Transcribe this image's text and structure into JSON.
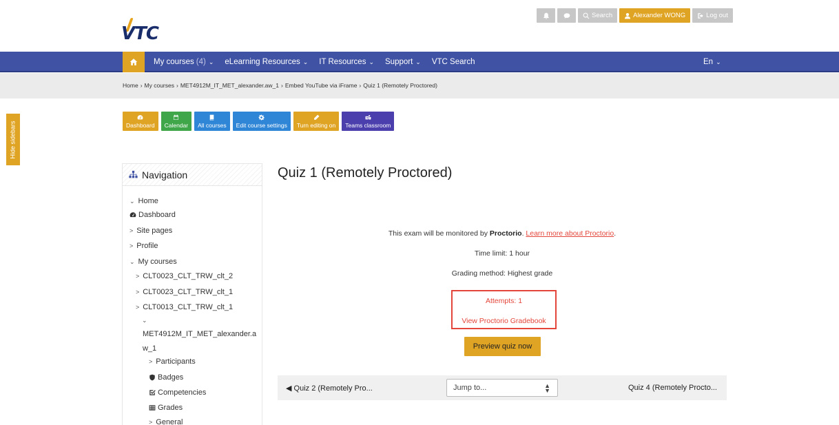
{
  "header": {
    "logo_text": "VTC",
    "search_label": "Search",
    "user_label": "Alexander WONG",
    "logout_label": "Log out"
  },
  "navbar": {
    "my_courses": "My courses",
    "my_courses_count": "(4)",
    "elearning": "eLearning Resources",
    "it_resources": "IT Resources",
    "support": "Support",
    "vtc_search": "VTC Search",
    "lang": "En"
  },
  "breadcrumb": {
    "home": "Home",
    "my_courses": "My courses",
    "course": "MET4912M_IT_MET_alexander.aw_1",
    "section": "Embed YouTube via iFrame",
    "current": "Quiz 1 (Remotely Proctored)"
  },
  "hide_sidebars": "Hide sidebars",
  "course_buttons": {
    "dashboard": "Dashboard",
    "calendar": "Calendar",
    "all_courses": "All courses",
    "edit_settings": "Edit course settings",
    "editing_on": "Turn editing on",
    "teams": "Teams classroom"
  },
  "navigation": {
    "title": "Navigation",
    "home": "Home",
    "dashboard": "Dashboard",
    "site_pages": "Site pages",
    "profile": "Profile",
    "my_courses": "My courses",
    "course1": "CLT0023_CLT_TRW_clt_2",
    "course2": "CLT0023_CLT_TRW_clt_1",
    "course3": "CLT0013_CLT_TRW_clt_1",
    "course4_line1": "MET4912M_IT_MET_alexander.a",
    "course4_line2": "w_1",
    "participants": "Participants",
    "badges": "Badges",
    "competencies": "Competencies",
    "grades": "Grades",
    "general": "General"
  },
  "main": {
    "title": "Quiz 1 (Remotely Proctored)",
    "monitored_prefix": "This exam will be monitored by ",
    "monitored_brand": "Proctorio",
    "monitored_suffix": ". ",
    "learn_more": "Learn more about Proctorio",
    "learn_more_end": ".",
    "time_limit": "Time limit: 1 hour",
    "grading": "Grading method: Highest grade",
    "attempts": "Attempts: 1",
    "gradebook": "View Proctorio Gradebook",
    "preview": "Preview quiz now"
  },
  "pager": {
    "prev": "Quiz 2 (Remotely Pro...",
    "jump": "Jump to...",
    "next": "Quiz 4 (Remotely Procto..."
  },
  "colors": {
    "navbar": "#3f52a3",
    "accent": "#e0a424",
    "highlight": "#e4453a"
  }
}
